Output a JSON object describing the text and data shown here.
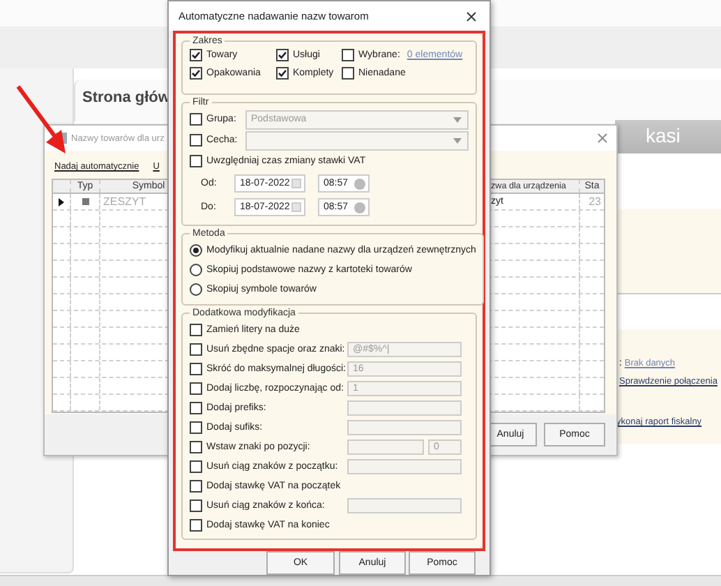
{
  "background": {
    "tab_title": "Strona głów",
    "banner_text": "kasi",
    "status_label": ":",
    "status_link": "Brak danych",
    "links": [
      "Sprawdzenie połączenia",
      "ykonaj raport fiskalny"
    ]
  },
  "names_window": {
    "title": "Nazwy towarów dla urz",
    "links": [
      "Nadaj automatycznie",
      "U"
    ],
    "columns": [
      "Typ",
      "Symbol",
      "zwa dla urządzenia",
      "Sta"
    ],
    "rows": [
      {
        "selected": true,
        "symbol": "ZESZYT",
        "device_name": "zyt",
        "column_4": "23"
      }
    ],
    "buttons": [
      "Anuluj",
      "Pomoc"
    ]
  },
  "dialog": {
    "title": "Automatyczne nadawanie nazw towarom",
    "scope": {
      "legend": "Zakres",
      "options": [
        {
          "label": "Towary",
          "checked": true
        },
        {
          "label": "Usługi",
          "checked": true
        },
        {
          "label": "Wybrane:",
          "checked": false,
          "link": "0 elementów"
        },
        {
          "label": "Opakowania",
          "checked": true
        },
        {
          "label": "Komplety",
          "checked": true
        },
        {
          "label": "Nienadane",
          "checked": false
        }
      ]
    },
    "filter": {
      "legend": "Filtr",
      "group": {
        "label": "Grupa:",
        "checked": false,
        "value": "Podstawowa"
      },
      "feature": {
        "label": "Cecha:",
        "checked": false
      },
      "vat_time": {
        "label": "Uwzględniaj czas zmiany stawki VAT",
        "checked": false
      },
      "ranges": [
        {
          "label": "Od:",
          "date": "18-07-2022",
          "time": "08:57"
        },
        {
          "label": "Do:",
          "date": "18-07-2022",
          "time": "08:57"
        }
      ]
    },
    "method": {
      "legend": "Metoda",
      "options": [
        {
          "label": "Modyfikuj aktualnie nadane nazwy dla urządzeń zewnętrznych",
          "selected": true
        },
        {
          "label": "Skopiuj podstawowe nazwy z kartoteki towarów",
          "selected": false
        },
        {
          "label": "Skopiuj symbole towarów",
          "selected": false
        }
      ]
    },
    "extra": {
      "legend": "Dodatkowa modyfikacja",
      "options": [
        {
          "kind": "plain",
          "label": "Zamień litery na duże",
          "checked": false
        },
        {
          "kind": "field",
          "label": "Usuń zbędne spacje oraz znaki:",
          "checked": false,
          "value": "@#$%^|"
        },
        {
          "kind": "field",
          "label": "Skróć do maksymalnej długości:",
          "checked": false,
          "value": "16"
        },
        {
          "kind": "field",
          "label": "Dodaj liczbę, rozpoczynając od:",
          "checked": false,
          "value": "1"
        },
        {
          "kind": "field",
          "label": "Dodaj prefiks:",
          "checked": false
        },
        {
          "kind": "field",
          "label": "Dodaj sufiks:",
          "checked": false
        },
        {
          "kind": "pair",
          "label": "Wstaw znaki po pozycji:",
          "checked": false,
          "second_value": "0"
        },
        {
          "kind": "field",
          "label": "Usuń ciąg znaków z początku:",
          "checked": false
        },
        {
          "kind": "plain",
          "label": "Dodaj stawkę VAT na początek",
          "checked": false
        },
        {
          "kind": "field",
          "label": "Usuń ciąg znaków z końca:",
          "checked": false
        },
        {
          "kind": "plain",
          "label": "Dodaj stawkę VAT na koniec",
          "checked": false
        }
      ]
    },
    "buttons": [
      "OK",
      "Anuluj",
      "Pomoc"
    ]
  }
}
